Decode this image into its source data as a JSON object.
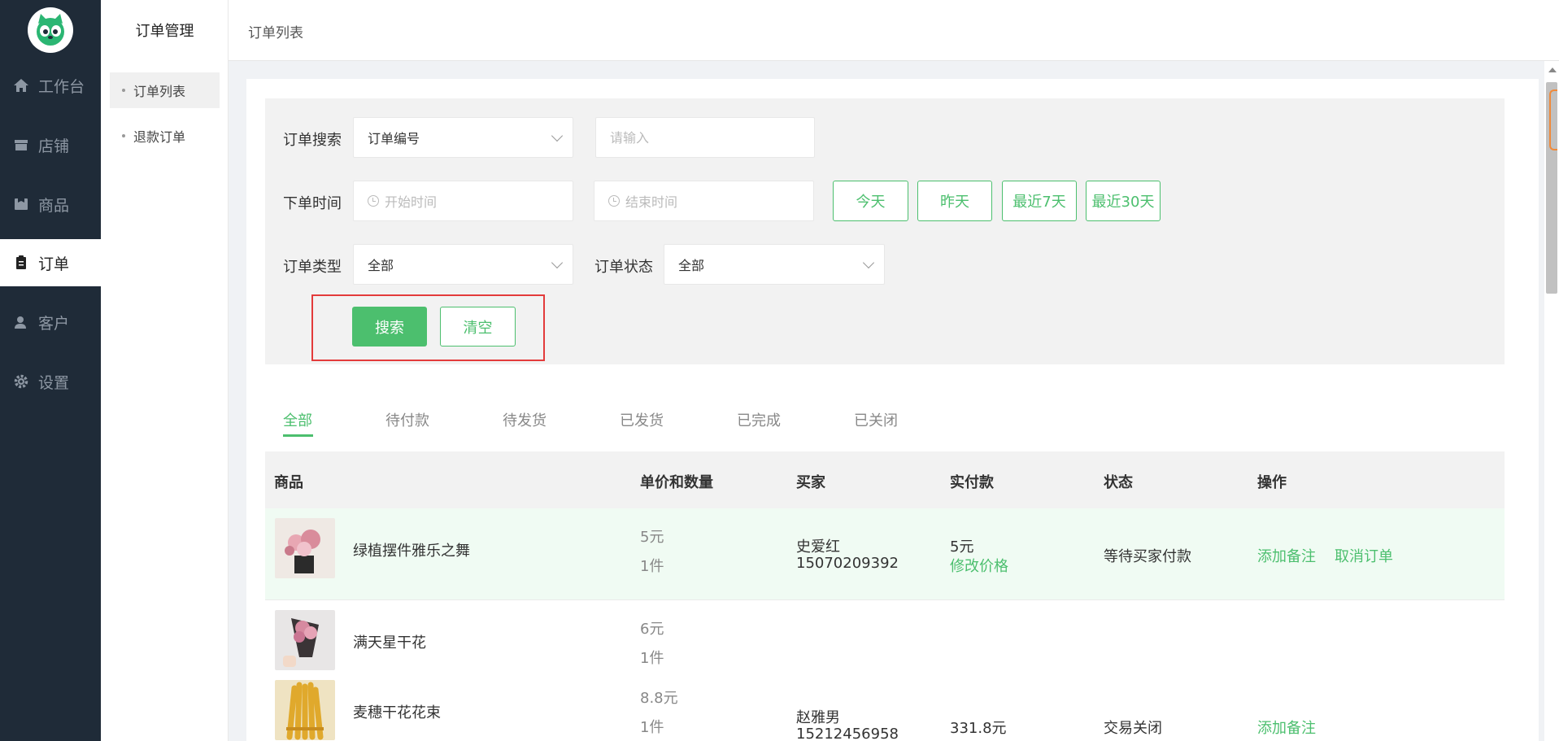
{
  "nav": {
    "items": [
      {
        "label": "工作台",
        "icon": "home-icon"
      },
      {
        "label": "店铺",
        "icon": "store-icon"
      },
      {
        "label": "商品",
        "icon": "product-icon"
      },
      {
        "label": "订单",
        "icon": "order-icon"
      },
      {
        "label": "客户",
        "icon": "customer-icon"
      },
      {
        "label": "设置",
        "icon": "gear-icon"
      }
    ]
  },
  "subnav": {
    "title": "订单管理",
    "items": [
      {
        "label": "订单列表"
      },
      {
        "label": "退款订单"
      }
    ]
  },
  "header": {
    "breadcrumb": "订单列表"
  },
  "search": {
    "order_search_label": "订单搜索",
    "order_search_field": "订单编号",
    "order_input_placeholder": "请输入",
    "time_label": "下单时间",
    "start_placeholder": "开始时间",
    "end_placeholder": "结束时间",
    "quick": [
      "今天",
      "昨天",
      "最近7天",
      "最近30天"
    ],
    "type_label": "订单类型",
    "type_value": "全部",
    "status_label": "订单状态",
    "status_value": "全部",
    "search_button": "搜索",
    "clear_button": "清空"
  },
  "tabs": [
    "全部",
    "待付款",
    "待发货",
    "已发货",
    "已完成",
    "已关闭"
  ],
  "table": {
    "headers": [
      "商品",
      "单价和数量",
      "买家",
      "实付款",
      "状态",
      "操作"
    ],
    "orders": [
      {
        "items": [
          {
            "name": "绿植摆件雅乐之舞",
            "price": "5元",
            "qty": "1件"
          }
        ],
        "buyer_name": "史爱红",
        "buyer_phone": "15070209392",
        "paid": "5元",
        "edit_price": "修改价格",
        "status": "等待买家付款",
        "actions": [
          "添加备注",
          "取消订单"
        ]
      },
      {
        "items": [
          {
            "name": "满天星干花",
            "price": "6元",
            "qty": "1件"
          },
          {
            "name": "麦穗干花花束",
            "price": "8.8元",
            "qty": "1件"
          }
        ],
        "buyer_name": "赵雅男",
        "buyer_phone": "15212456958",
        "paid": "331.8元",
        "status": "交易关闭",
        "actions": [
          "添加备注"
        ]
      }
    ]
  },
  "colors": {
    "accent": "#4cbf6e",
    "nav_bg": "#1f2b38",
    "highlight": "#e33b3b"
  }
}
